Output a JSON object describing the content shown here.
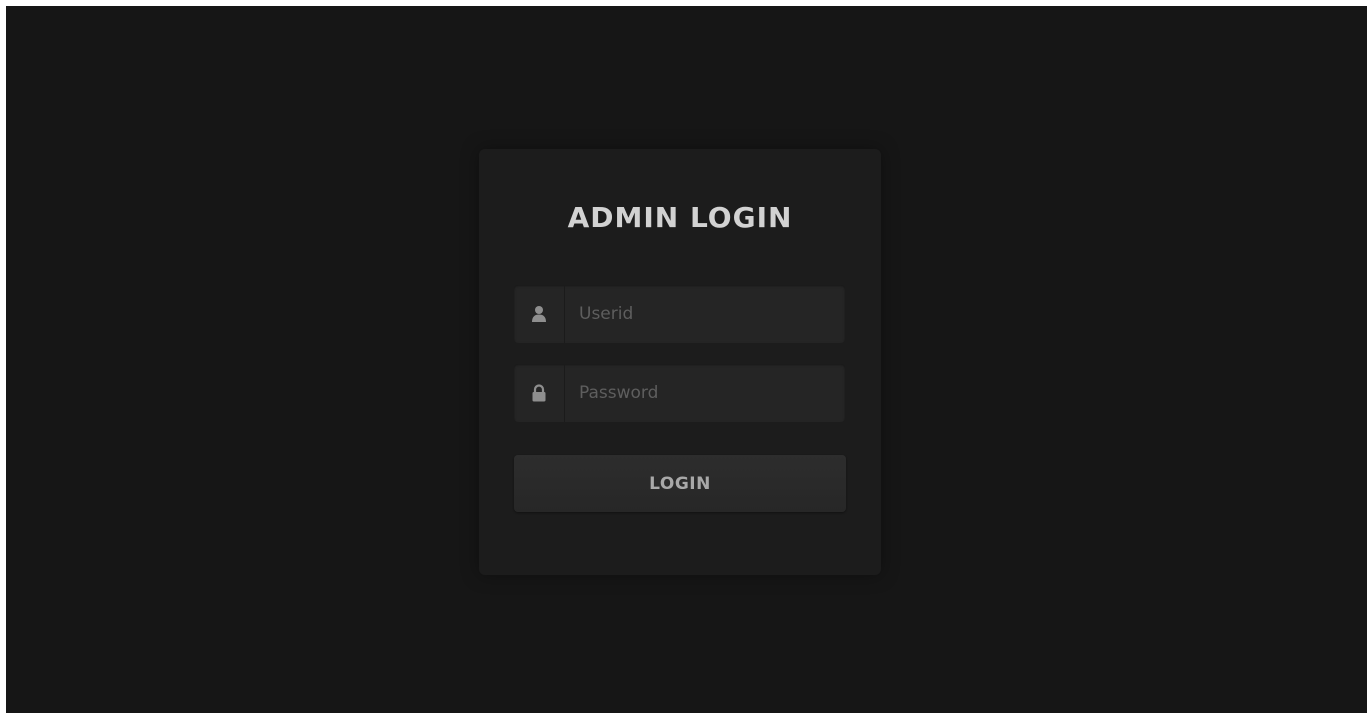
{
  "login_card": {
    "title": "ADMIN LOGIN",
    "userid_field": {
      "placeholder": "Userid",
      "value": "",
      "icon": "user-icon"
    },
    "password_field": {
      "placeholder": "Password",
      "value": "",
      "icon": "lock-icon"
    },
    "login_button_label": "LOGIN"
  },
  "colors": {
    "background": "#161616",
    "card": "#1c1c1c",
    "field": "#252525",
    "title_text": "#d2d2d2",
    "button_text": "#a8a8a8"
  }
}
